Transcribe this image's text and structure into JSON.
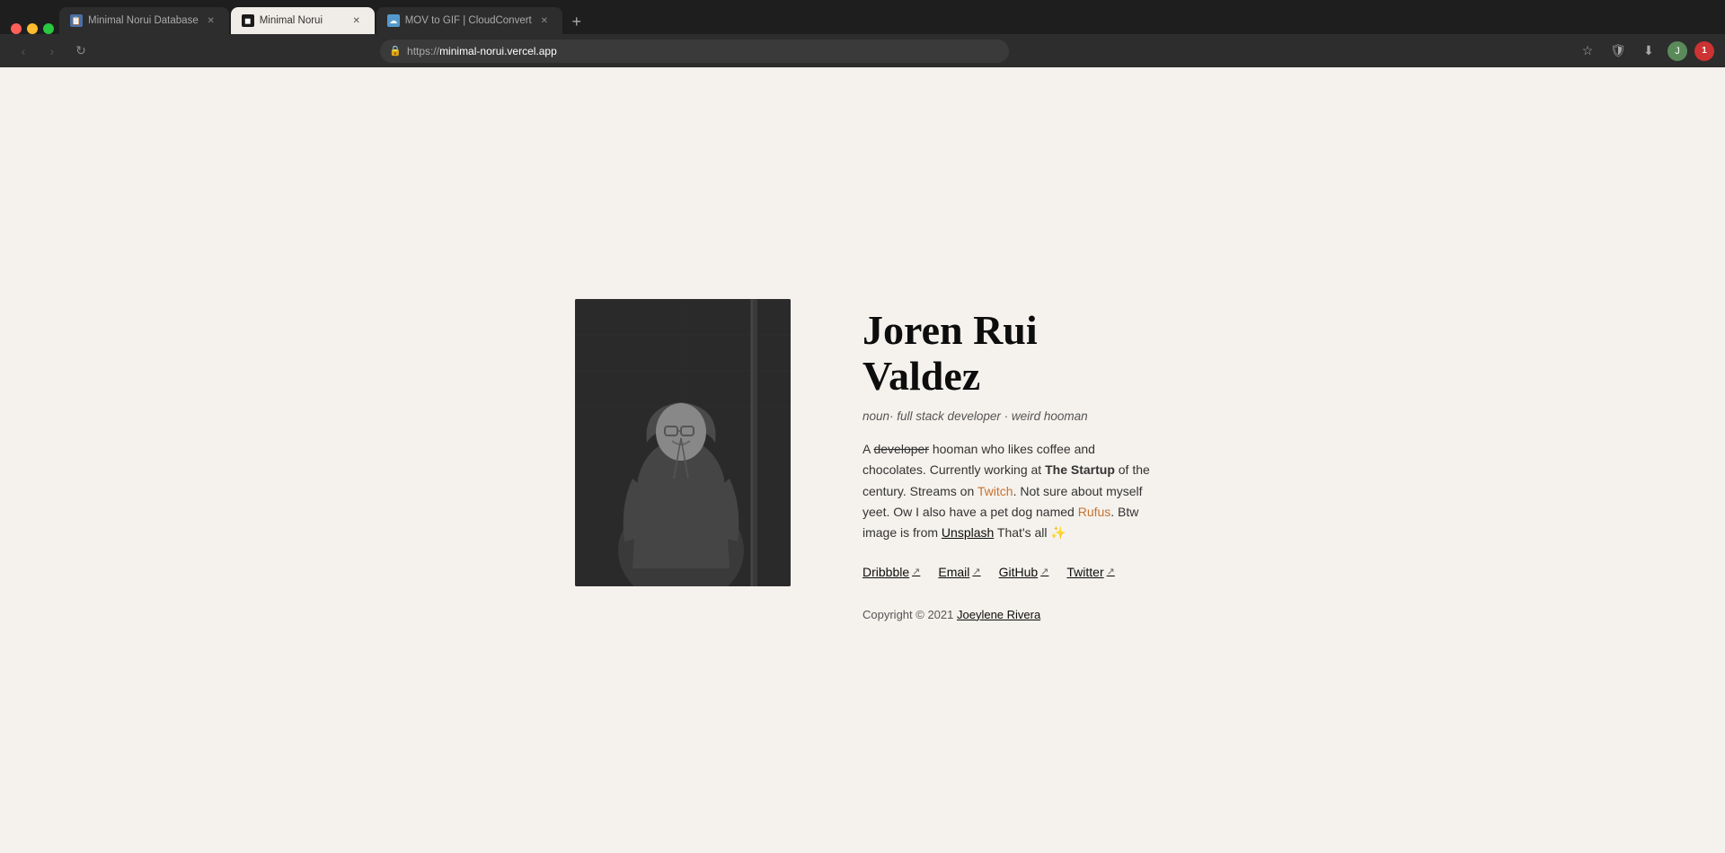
{
  "browser": {
    "tabs": [
      {
        "id": "tab-1",
        "title": "Minimal Norui Database",
        "favicon": "📋",
        "active": false,
        "closeable": true
      },
      {
        "id": "tab-2",
        "title": "Minimal Norui",
        "favicon": "◼",
        "active": true,
        "closeable": true
      },
      {
        "id": "tab-3",
        "title": "MOV to GIF | CloudConvert",
        "favicon": "☁",
        "active": false,
        "closeable": true
      }
    ],
    "new_tab_label": "+",
    "address": "https://minimal-norui.vercel.app",
    "address_protocol": "https://",
    "address_domain": "minimal-norui.vercel.app"
  },
  "profile": {
    "name": "Joren Rui Valdez",
    "subtitle_noun": "noun",
    "subtitle_desc": "· full stack developer · weird hooman",
    "description_part1": "A ",
    "description_strikethrough": "developer",
    "description_part2": " hooman who likes coffee and chocolates. Currently working at ",
    "description_bold": "The Startup",
    "description_part3": " of the century. Streams on ",
    "description_twitch": "Twitch",
    "description_part4": ". Not sure about myself yeet. Ow I also have a pet dog named ",
    "description_rufus": "Rufus",
    "description_part5": ". Btw image is from ",
    "description_unsplash": "Unsplash",
    "description_end": " That's all ✨",
    "social_links": [
      {
        "label": "Dribbble",
        "id": "dribbble"
      },
      {
        "label": "Email",
        "id": "email"
      },
      {
        "label": "GitHub",
        "id": "github"
      },
      {
        "label": "Twitter",
        "id": "twitter"
      }
    ],
    "copyright": "Copyright © 2021 ",
    "copyright_author": "Joeylene Rivera"
  }
}
